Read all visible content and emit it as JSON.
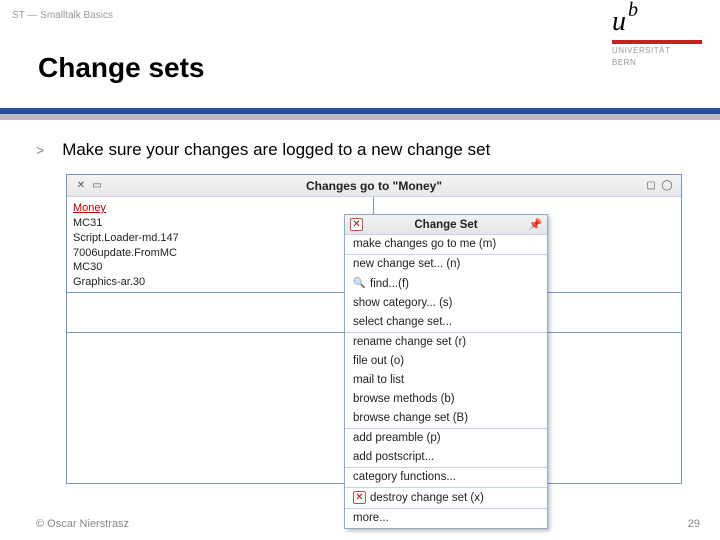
{
  "header": {
    "breadcrumb": "ST — Smalltalk Basics",
    "title": "Change sets",
    "logo": {
      "u": "u",
      "b": "b",
      "line1": "UNIVERSITÄT",
      "line2": "BERN"
    }
  },
  "bullet": {
    "chevron": ">",
    "text": "Make sure your changes are logged to a new change set"
  },
  "changes_window": {
    "title": "Changes go to \"Money\"",
    "left_pane": {
      "items": [
        "Money",
        "MC31",
        "Script.Loader-md.147",
        "7006update.FromMC",
        "MC30",
        "Graphics-ar.30"
      ]
    }
  },
  "menu": {
    "title": "Change Set",
    "groups": [
      [
        "make changes go to me (m)"
      ],
      [
        "new change set... (n)",
        "find...(f)",
        "show category... (s)",
        "select change set..."
      ],
      [
        "rename change set (r)",
        "file out (o)",
        "mail to list",
        "browse methods (b)",
        "browse change set (B)"
      ],
      [
        "add preamble (p)",
        "add postscript..."
      ],
      [
        "category functions..."
      ],
      [
        "destroy change set (x)"
      ],
      [
        "more..."
      ]
    ]
  },
  "footer": {
    "copyright": "© Oscar Nierstrasz",
    "page": "29"
  }
}
